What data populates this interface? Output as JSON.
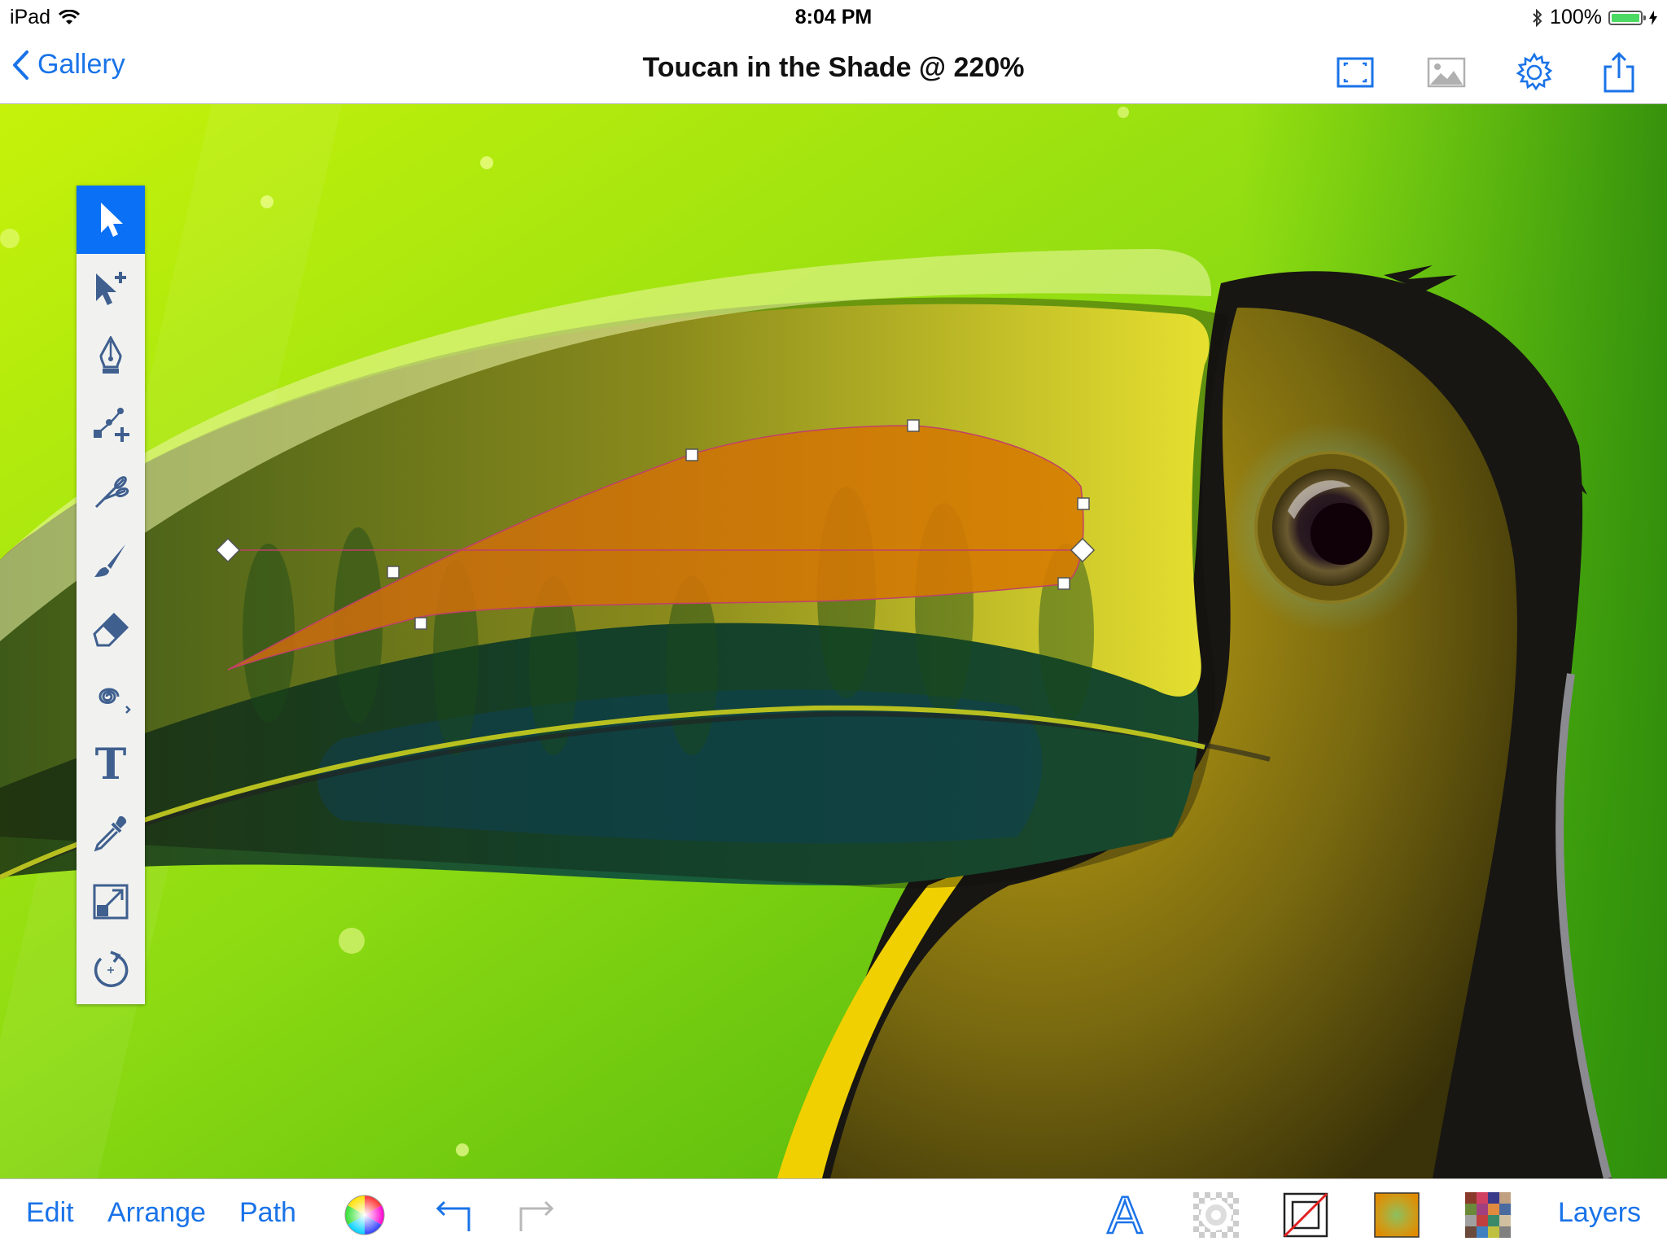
{
  "status_bar": {
    "device": "iPad",
    "time": "8:04 PM",
    "battery_percent": "100%",
    "battery_level": 1.0
  },
  "nav_bar": {
    "back_label": "Gallery",
    "title": "Toucan in the Shade @ 220%",
    "icons": [
      "fullscreen-icon",
      "image-icon",
      "gear-icon",
      "share-icon"
    ]
  },
  "tools": [
    {
      "name": "select",
      "icon": "arrow-pointer-icon",
      "active": true
    },
    {
      "name": "node-select",
      "icon": "node-select-icon",
      "active": false
    },
    {
      "name": "pen",
      "icon": "pen-nib-icon",
      "active": false
    },
    {
      "name": "add-anchor",
      "icon": "add-anchor-icon",
      "active": false
    },
    {
      "name": "scissors",
      "icon": "scissors-icon",
      "active": false
    },
    {
      "name": "brush",
      "icon": "brush-icon",
      "active": false
    },
    {
      "name": "eraser",
      "icon": "eraser-icon",
      "active": false
    },
    {
      "name": "spiral",
      "icon": "spiral-icon",
      "active": false
    },
    {
      "name": "text",
      "icon": "text-tool-icon",
      "active": false
    },
    {
      "name": "eyedropper",
      "icon": "eyedropper-icon",
      "active": false
    },
    {
      "name": "scale",
      "icon": "scale-icon",
      "active": false
    },
    {
      "name": "rotate",
      "icon": "rotate-icon",
      "active": false
    }
  ],
  "text_tool_glyph": "T",
  "bottom_bar": {
    "edit_label": "Edit",
    "arrange_label": "Arrange",
    "path_label": "Path",
    "layers_label": "Layers",
    "font_glyph": "A"
  },
  "colors": {
    "accent": "#1a73e8",
    "active_tool": "#0a70f5",
    "selection_fill": "#d57a00",
    "background_green": "#7ed321"
  }
}
